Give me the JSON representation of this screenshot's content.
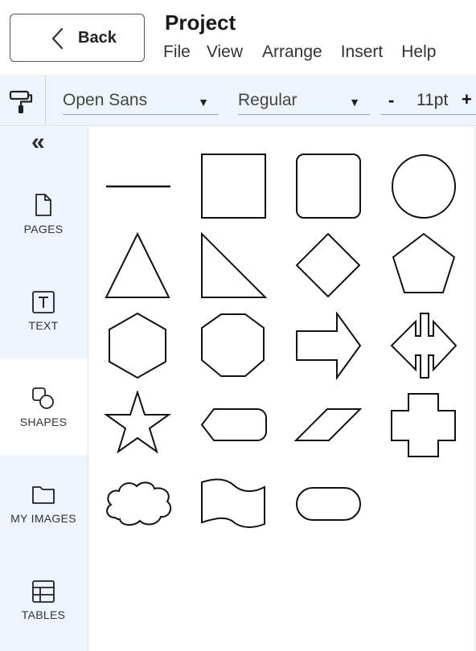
{
  "header": {
    "back_label": "Back",
    "title": "Project",
    "menu": [
      "File",
      "View",
      "Arrange",
      "Insert",
      "Help"
    ]
  },
  "toolbar": {
    "font_family": "Open Sans",
    "font_weight": "Regular",
    "size_minus": "-",
    "font_size": "11pt",
    "size_plus": "+"
  },
  "sidebar": {
    "collapse_glyph": "«",
    "items": [
      {
        "label": "PAGES",
        "icon": "page-icon"
      },
      {
        "label": "TEXT",
        "icon": "text-icon"
      },
      {
        "label": "SHAPES",
        "icon": "shapes-icon",
        "active": true
      },
      {
        "label": "MY IMAGES",
        "icon": "folder-icon"
      },
      {
        "label": "TABLES",
        "icon": "table-icon"
      }
    ]
  },
  "shapes": [
    "line",
    "square",
    "rounded-square",
    "circle",
    "triangle",
    "right-triangle",
    "diamond",
    "pentagon",
    "hexagon",
    "octagon",
    "arrow-right",
    "double-arrow",
    "star",
    "tag",
    "parallelogram",
    "cross",
    "cloud",
    "wave-banner",
    "pill"
  ]
}
